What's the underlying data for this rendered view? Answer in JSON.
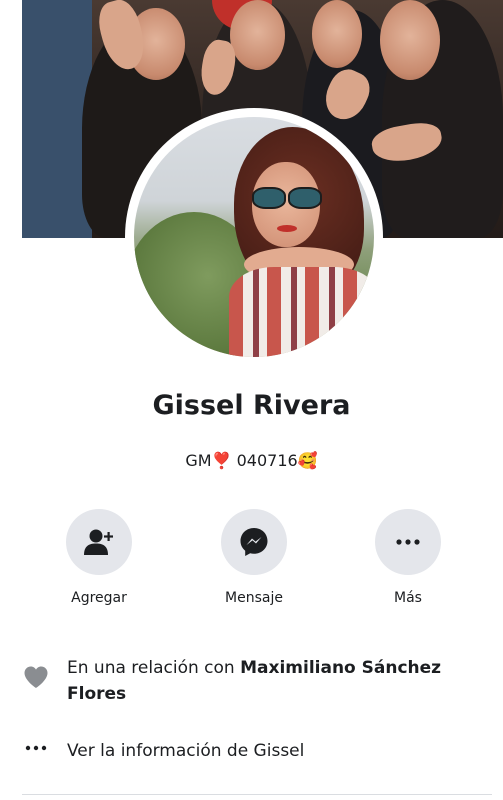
{
  "profile": {
    "name": "Gissel Rivera",
    "bio": "GM❣️ 040716🥰"
  },
  "actions": [
    {
      "label": "Agregar",
      "icon": "add-friend-icon"
    },
    {
      "label": "Mensaje",
      "icon": "messenger-icon"
    },
    {
      "label": "Más",
      "icon": "more-icon"
    }
  ],
  "info": {
    "relationship_prefix": "En una relación con ",
    "relationship_partner": "Maximiliano Sánchez Flores",
    "about_label": "Ver la información de Gissel"
  },
  "colors": {
    "button_bg": "#e4e6eb",
    "heart_icon": "#8a8d91",
    "text": "#1c1e21"
  }
}
